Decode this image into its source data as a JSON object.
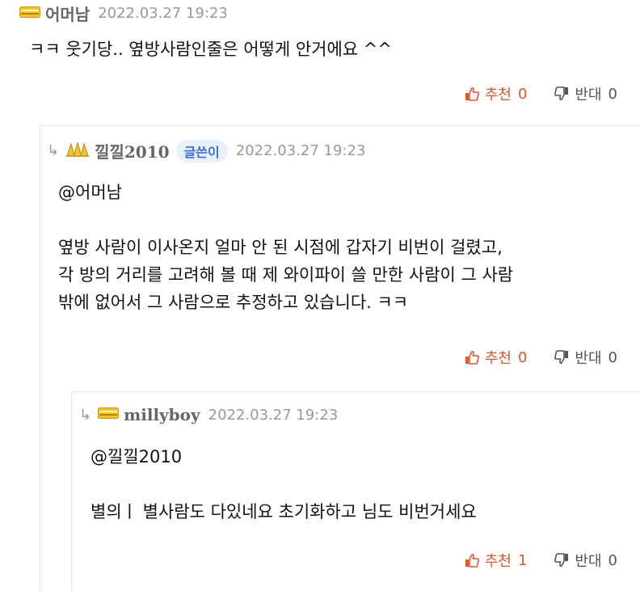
{
  "comments": [
    {
      "nick": "어머남",
      "date": "2022.03.27 19:23",
      "body": [
        "ㅋㅋ 웃기당.. 옆방사람인줄은 어떻게 안거에요 ^^"
      ],
      "recommend_label": "추천",
      "recommend_count": "0",
      "oppose_label": "반대",
      "oppose_count": "0"
    },
    {
      "nick": "낄낄2010",
      "badge": "글쓴이",
      "date": "2022.03.27 19:23",
      "mention": "@어머남",
      "body": [
        "옆방 사람이 이사온지 얼마 안 된 시점에 갑자기 비번이 걸렸고,",
        "각 방의 거리를 고려해 볼 때 제 와이파이 쓸 만한 사람이 그 사람",
        "밖에 없어서 그 사람으로 추정하고 있습니다.  ㅋㅋ"
      ],
      "recommend_label": "추천",
      "recommend_count": "0",
      "oppose_label": "반대",
      "oppose_count": "0"
    },
    {
      "nick": "millyboy",
      "date": "2022.03.27 19:23",
      "mention": "@낄낄2010",
      "body": [
        "별의ㅣ  별사람도 다있네요 초기화하고 님도 비번거세요"
      ],
      "recommend_label": "추천",
      "recommend_count": "1",
      "oppose_label": "반대",
      "oppose_count": "0"
    }
  ],
  "icons": {
    "reply_arrow": "↳",
    "level_bar": "yellow-level-bar-icon",
    "level_crown": "gold-level-icon",
    "thumbs_up": "thumbs-up-icon",
    "thumbs_down": "thumbs-down-icon"
  },
  "colors": {
    "recommend": "#e0562a",
    "badge_bg": "#e8f0fe",
    "badge_text": "#3b6fd8"
  }
}
